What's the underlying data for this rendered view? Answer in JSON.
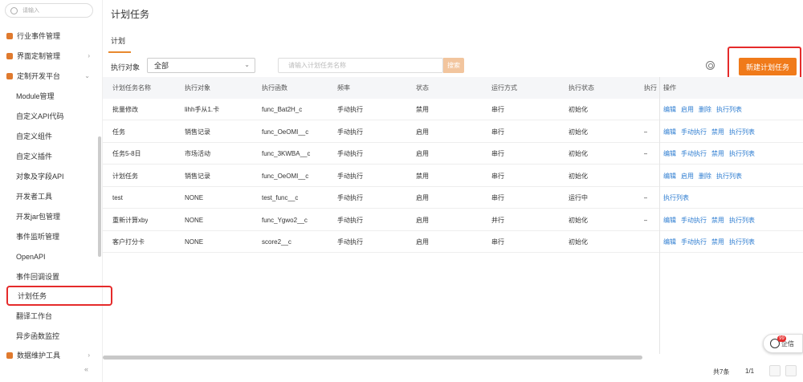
{
  "sidebar": {
    "search_placeholder": "请输入",
    "items": [
      {
        "label": "行业事件管理",
        "top": true,
        "arrow": ""
      },
      {
        "label": "界面定制管理",
        "top": true,
        "arrow": "›"
      },
      {
        "label": "定制开发平台",
        "top": true,
        "arrow": "⌄"
      },
      {
        "label": "Module管理",
        "top": false
      },
      {
        "label": "自定义API代码",
        "top": false
      },
      {
        "label": "自定义组件",
        "top": false
      },
      {
        "label": "自定义插件",
        "top": false
      },
      {
        "label": "对象及字段API",
        "top": false
      },
      {
        "label": "开发者工具",
        "top": false
      },
      {
        "label": "开发jar包管理",
        "top": false
      },
      {
        "label": "事件监听管理",
        "top": false
      },
      {
        "label": "OpenAPI",
        "top": false
      },
      {
        "label": "事件回调设置",
        "top": false
      },
      {
        "label": "计划任务",
        "top": false,
        "active": true
      },
      {
        "label": "翻译工作台",
        "top": false
      },
      {
        "label": "异步函数监控",
        "top": false
      },
      {
        "label": "数据维护工具",
        "top": true,
        "arrow": "›"
      }
    ],
    "collapse": "«"
  },
  "main": {
    "title": "计划任务",
    "tab": "计划",
    "filter_label": "执行对象",
    "filter_value": "全部",
    "search_placeholder": "请输入计划任务名称",
    "search_button": "搜索",
    "new_button": "新建计划任务"
  },
  "table": {
    "headers": [
      "计划任务名称",
      "执行对象",
      "执行函数",
      "频率",
      "状态",
      "运行方式",
      "执行状态",
      "执行",
      "操作"
    ],
    "rows": [
      {
        "name": "批量修改",
        "obj": "lihh手从1.卡",
        "func": "func_Bat2H_c",
        "freq": "手动执行",
        "status": "禁用",
        "mode": "串行",
        "exec": "初始化",
        "x": "",
        "ops": [
          "编辑",
          "启用",
          "删除",
          "执行列表"
        ]
      },
      {
        "name": "任务",
        "obj": "销售记录",
        "func": "func_OeOMI__c",
        "freq": "手动执行",
        "status": "启用",
        "mode": "串行",
        "exec": "初始化",
        "x": "–",
        "ops": [
          "编辑",
          "手动执行",
          "禁用",
          "执行列表"
        ]
      },
      {
        "name": "任务5-8日",
        "obj": "市场活动",
        "func": "func_3KWBA__c",
        "freq": "手动执行",
        "status": "启用",
        "mode": "串行",
        "exec": "初始化",
        "x": "–",
        "ops": [
          "编辑",
          "手动执行",
          "禁用",
          "执行列表"
        ]
      },
      {
        "name": "计划任务",
        "obj": "销售记录",
        "func": "func_OeOMI__c",
        "freq": "手动执行",
        "status": "禁用",
        "mode": "串行",
        "exec": "初始化",
        "x": "",
        "ops": [
          "编辑",
          "启用",
          "删除",
          "执行列表"
        ]
      },
      {
        "name": "test",
        "obj": "NONE",
        "func": "test_func__c",
        "freq": "手动执行",
        "status": "启用",
        "mode": "串行",
        "exec": "运行中",
        "x": "–",
        "ops": [
          "执行列表"
        ]
      },
      {
        "name": "重新计算xby",
        "obj": "NONE",
        "func": "func_Ygwo2__c",
        "freq": "手动执行",
        "status": "启用",
        "mode": "并行",
        "exec": "初始化",
        "x": "–",
        "ops": [
          "编辑",
          "手动执行",
          "禁用",
          "执行列表"
        ]
      },
      {
        "name": "客户打分卡",
        "obj": "NONE",
        "func": "score2__c",
        "freq": "手动执行",
        "status": "启用",
        "mode": "串行",
        "exec": "初始化",
        "x": "",
        "ops": [
          "编辑",
          "手动执行",
          "禁用",
          "执行列表"
        ]
      }
    ]
  },
  "footer": {
    "total": "共7条",
    "pager": "1/1"
  },
  "chat": {
    "label": "企信",
    "badge": "99"
  }
}
